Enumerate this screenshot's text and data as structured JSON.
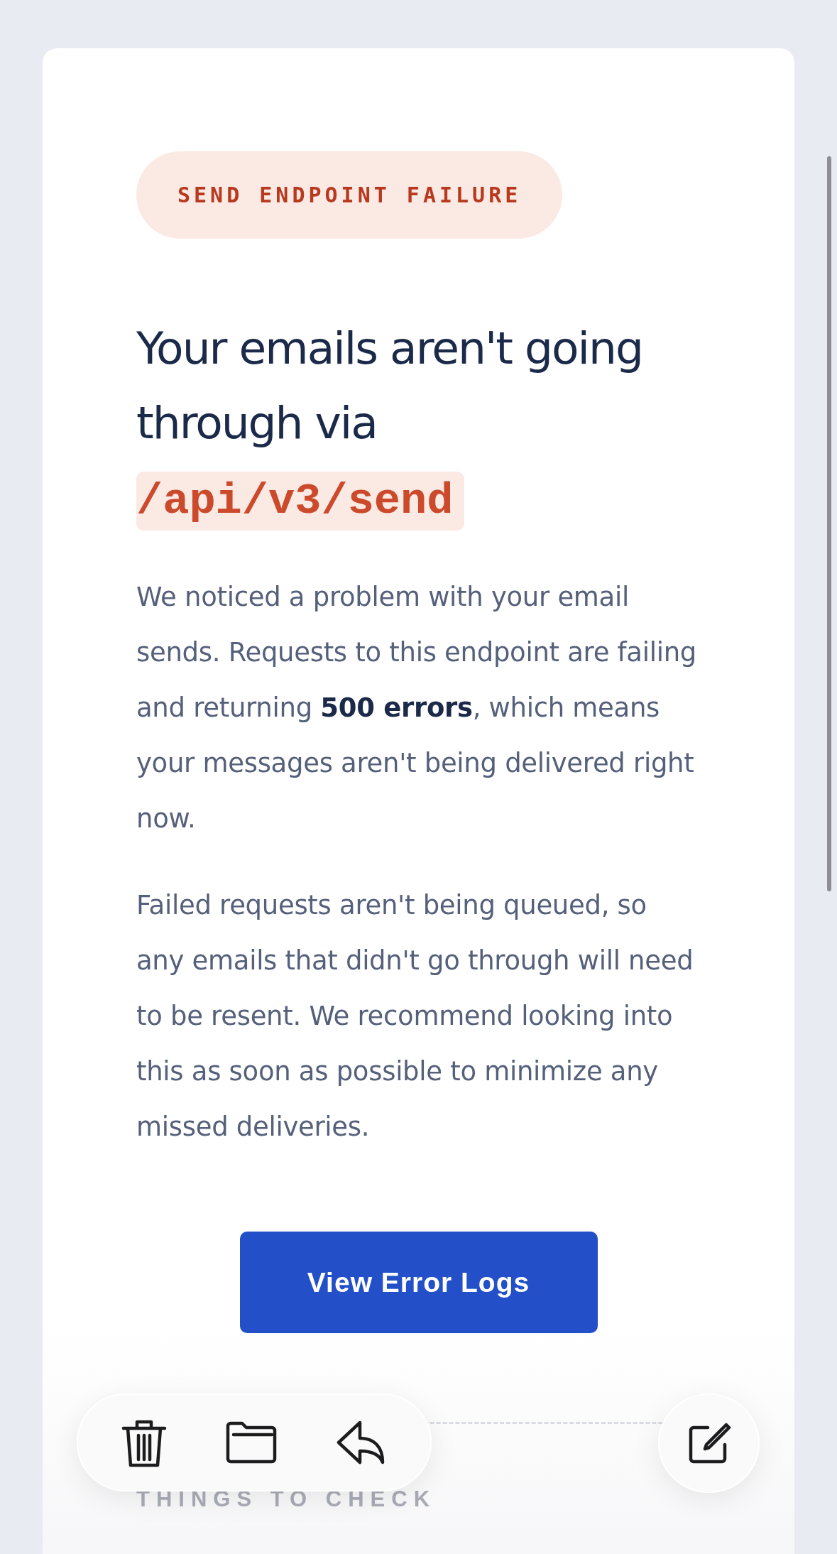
{
  "badge": "SEND ENDPOINT FAILURE",
  "heading": {
    "text": "Your emails aren't going through via",
    "code": "/api/v3/send"
  },
  "paragraphs": [
    "We noticed a problem with your email sends. Requests to this endpoint are failing and returning **500 errors**, which means your messages aren't being delivered right now.",
    "Failed requests aren't being queued, so any emails that didn't go through will need to be resent. We recommend looking into this as soon as possible to minimize any missed deliveries."
  ],
  "button": "View Error Logs",
  "section_title": "THINGS TO CHECK",
  "toolbar": [
    {
      "kind": "trash"
    },
    {
      "kind": "folder"
    },
    {
      "kind": "reply"
    }
  ],
  "compose": {
    "kind": "compose"
  }
}
